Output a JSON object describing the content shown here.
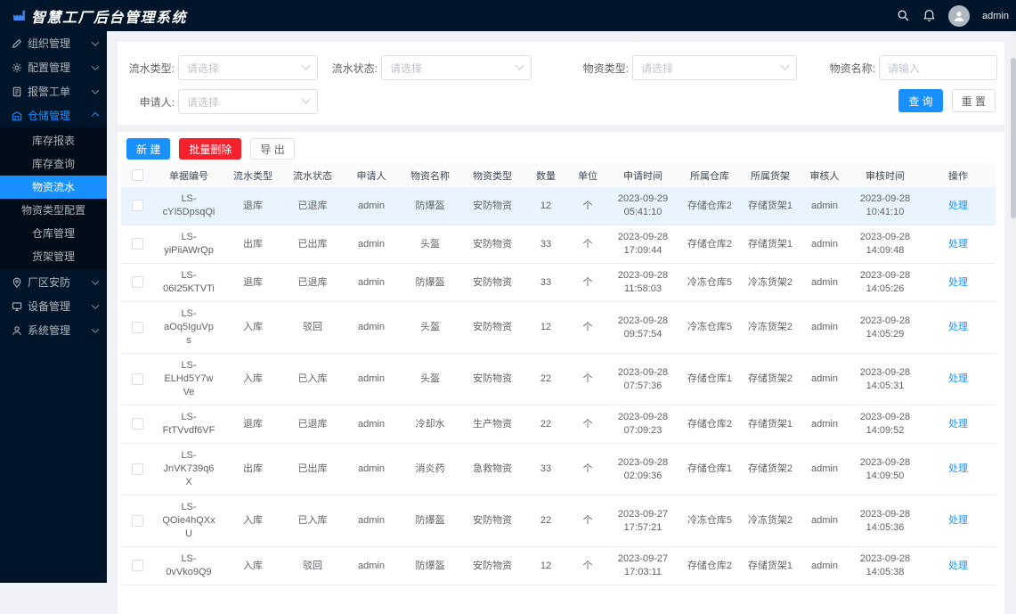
{
  "app": {
    "title": "智慧工厂后台管理系统",
    "user": "admin"
  },
  "colors": {
    "primary": "#1890ff",
    "danger": "#f5222d",
    "sidebar_bg": "#001529",
    "submenu_bg": "#000c17",
    "row_highlight": "#e8f4ff"
  },
  "topbar": {
    "icons": [
      "search-icon",
      "bell-icon"
    ],
    "username": "admin"
  },
  "sidebar": {
    "items": [
      {
        "label": "组织管理",
        "icon": "pen-icon",
        "state": "collapsed"
      },
      {
        "label": "配置管理",
        "icon": "gear-icon",
        "state": "collapsed"
      },
      {
        "label": "报警工单",
        "icon": "document-icon",
        "state": "collapsed"
      },
      {
        "label": "仓储管理",
        "icon": "warehouse-icon",
        "state": "expanded",
        "active": true,
        "children": [
          {
            "label": "库存报表"
          },
          {
            "label": "库存查询"
          },
          {
            "label": "物资流水",
            "selected": true
          },
          {
            "label": "物资类型配置"
          },
          {
            "label": "仓库管理"
          },
          {
            "label": "货架管理"
          }
        ]
      },
      {
        "label": "厂区安防",
        "icon": "pin-icon",
        "state": "collapsed"
      },
      {
        "label": "设备管理",
        "icon": "device-icon",
        "state": "collapsed"
      },
      {
        "label": "系统管理",
        "icon": "settings-icon",
        "state": "collapsed"
      }
    ]
  },
  "filters": {
    "row1": [
      {
        "label": "流水类型:",
        "placeholder": "请选择",
        "type": "select"
      },
      {
        "label": "流水状态:",
        "placeholder": "请选择",
        "type": "select"
      },
      {
        "label": "物资类型:",
        "placeholder": "请选择",
        "type": "select"
      },
      {
        "label": "物资名称:",
        "placeholder": "请输入",
        "type": "input"
      }
    ],
    "row2": [
      {
        "label": "申请人:",
        "placeholder": "请选择",
        "type": "select"
      }
    ],
    "search_label": "查 询",
    "reset_label": "重 置"
  },
  "toolbar": {
    "new_label": "新 建",
    "batch_delete_label": "批量删除",
    "export_label": "导 出"
  },
  "table": {
    "headers": [
      "单据编号",
      "流水类型",
      "流水状态",
      "申请人",
      "物资名称",
      "物资类型",
      "数量",
      "单位",
      "申请时间",
      "所属仓库",
      "所属货架",
      "审核人",
      "审核时间",
      "操作"
    ],
    "action_label": "处理",
    "rows": [
      {
        "id_lines": [
          "LS-",
          "cYI5DpsqQi"
        ],
        "type": "退库",
        "status": "已退库",
        "applicant": "admin",
        "name": "防爆盔",
        "category": "安防物资",
        "qty": "12",
        "unit": "个",
        "apply_time": "2023-09-29 05:41:10",
        "warehouse": "存储仓库2",
        "shelf": "存储货架1",
        "auditor": "admin",
        "audit_time": "2023-09-28 10:41:10",
        "highlighted": true
      },
      {
        "id_lines": [
          "LS-",
          "yiPiiAWrQp"
        ],
        "type": "出库",
        "status": "已出库",
        "applicant": "admin",
        "name": "头盔",
        "category": "安防物资",
        "qty": "33",
        "unit": "个",
        "apply_time": "2023-09-28 17:09:44",
        "warehouse": "存储仓库2",
        "shelf": "存储货架1",
        "auditor": "admin",
        "audit_time": "2023-09-28 14:09:48"
      },
      {
        "id_lines": [
          "LS-",
          "06I25KTVTi"
        ],
        "type": "退库",
        "status": "已退库",
        "applicant": "admin",
        "name": "防爆盔",
        "category": "安防物资",
        "qty": "33",
        "unit": "个",
        "apply_time": "2023-09-28 11:58:03",
        "warehouse": "冷冻仓库5",
        "shelf": "冷冻货架2",
        "auditor": "admin",
        "audit_time": "2023-09-28 14:05:26"
      },
      {
        "id_lines": [
          "LS-",
          "aOq5IguVp",
          "s"
        ],
        "type": "入库",
        "status": "驳回",
        "applicant": "admin",
        "name": "头盔",
        "category": "安防物资",
        "qty": "12",
        "unit": "个",
        "apply_time": "2023-09-28 09:57:54",
        "warehouse": "冷冻仓库5",
        "shelf": "冷冻货架2",
        "auditor": "admin",
        "audit_time": "2023-09-28 14:05:29"
      },
      {
        "id_lines": [
          "LS-",
          "ELHd5Y7w",
          "Ve"
        ],
        "type": "入库",
        "status": "已入库",
        "applicant": "admin",
        "name": "头盔",
        "category": "安防物资",
        "qty": "22",
        "unit": "个",
        "apply_time": "2023-09-28 07:57:36",
        "warehouse": "存储仓库1",
        "shelf": "存储货架2",
        "auditor": "admin",
        "audit_time": "2023-09-28 14:05:31"
      },
      {
        "id_lines": [
          "LS-",
          "FtTVvdf6VF"
        ],
        "type": "退库",
        "status": "已退库",
        "applicant": "admin",
        "name": "冷却水",
        "category": "生产物资",
        "qty": "22",
        "unit": "个",
        "apply_time": "2023-09-28 07:09:23",
        "warehouse": "存储仓库2",
        "shelf": "存储货架1",
        "auditor": "admin",
        "audit_time": "2023-09-28 14:09:52"
      },
      {
        "id_lines": [
          "LS-",
          "JnVK739q6",
          "X"
        ],
        "type": "出库",
        "status": "已出库",
        "applicant": "admin",
        "name": "消炎药",
        "category": "急救物资",
        "qty": "33",
        "unit": "个",
        "apply_time": "2023-09-28 02:09:36",
        "warehouse": "存储仓库1",
        "shelf": "存储货架2",
        "auditor": "admin",
        "audit_time": "2023-09-28 14:09:50"
      },
      {
        "id_lines": [
          "LS-",
          "QOie4hQXx",
          "U"
        ],
        "type": "入库",
        "status": "已入库",
        "applicant": "admin",
        "name": "防爆盔",
        "category": "安防物资",
        "qty": "22",
        "unit": "个",
        "apply_time": "2023-09-27 17:57:21",
        "warehouse": "冷冻仓库5",
        "shelf": "冷冻货架2",
        "auditor": "admin",
        "audit_time": "2023-09-28 14:05:36"
      },
      {
        "id_lines": [
          "LS-",
          "0vVko9Q9"
        ],
        "type": "入库",
        "status": "驳回",
        "applicant": "admin",
        "name": "防爆盔",
        "category": "安防物资",
        "qty": "12",
        "unit": "个",
        "apply_time": "2023-09-27 17:03:11",
        "warehouse": "存储仓库2",
        "shelf": "存储货架1",
        "auditor": "admin",
        "audit_time": "2023-09-28 14:05:38"
      }
    ]
  }
}
